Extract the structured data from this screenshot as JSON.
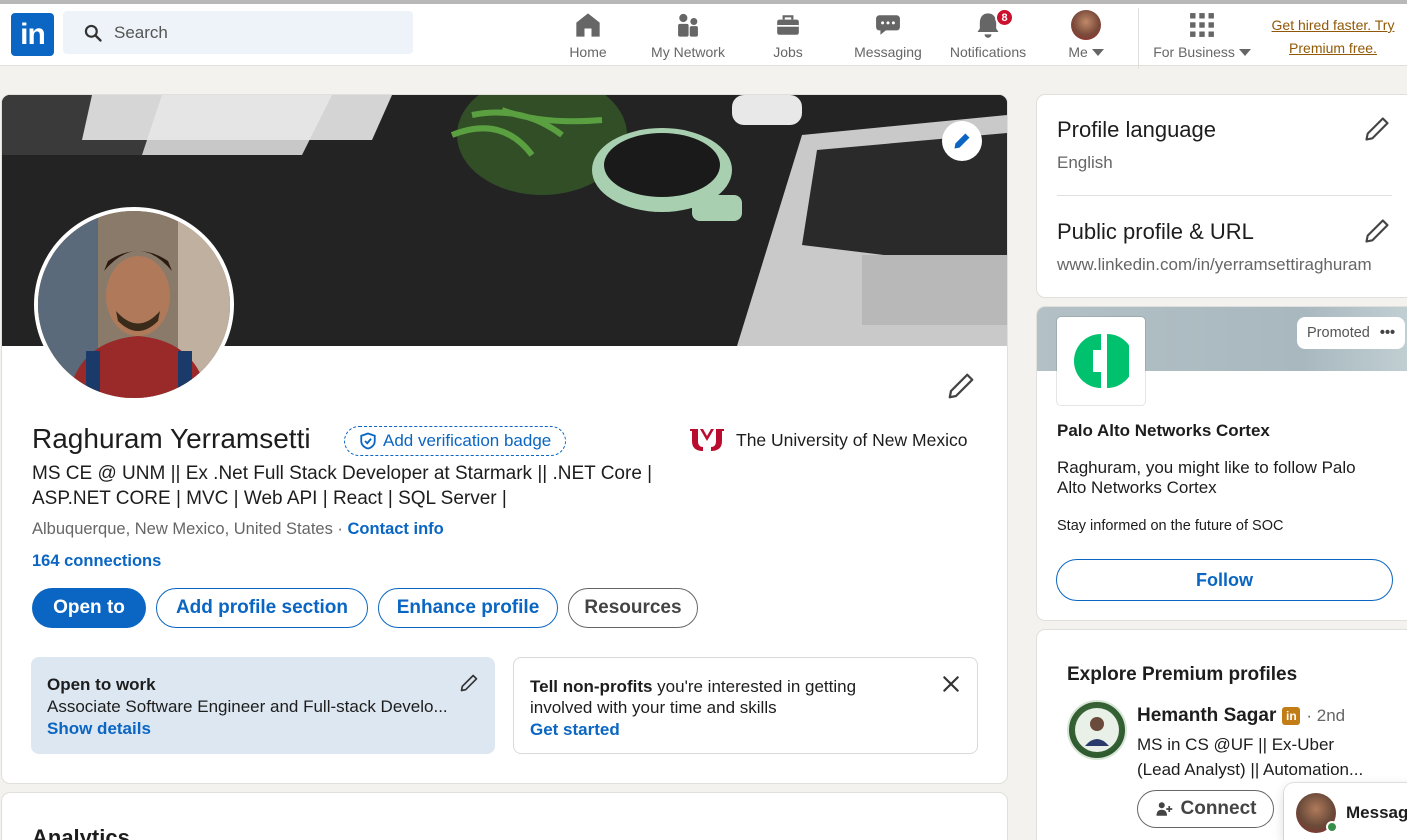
{
  "nav": {
    "logo": "in",
    "search_placeholder": "Search",
    "items": [
      {
        "label": "Home"
      },
      {
        "label": "My Network"
      },
      {
        "label": "Jobs"
      },
      {
        "label": "Messaging"
      },
      {
        "label": "Notifications",
        "badge": "8"
      },
      {
        "label": "Me"
      },
      {
        "label": "For Business"
      }
    ],
    "premium_line1": "Get hired faster. Try",
    "premium_line2": "Premium free."
  },
  "profile": {
    "name": "Raghuram Yerramsetti",
    "verify_badge": "Add verification badge",
    "headline": "MS CE @ UNM || Ex .Net Full Stack Developer at Starmark || .NET Core | ASP.NET CORE | MVC | Web API | React | SQL Server |",
    "school": "The University of New Mexico",
    "location": "Albuquerque, New Mexico, United States",
    "location_sep": " · ",
    "contact_info": "Contact info",
    "connections": "164 connections",
    "buttons": {
      "open_to": "Open to",
      "add_section": "Add profile section",
      "enhance": "Enhance profile",
      "resources": "Resources"
    },
    "open_to_work": {
      "title": "Open to work",
      "roles": "Associate Software Engineer and Full-stack Develo...",
      "link": "Show details"
    },
    "nonprofits": {
      "bold": "Tell non-profits",
      "text": " you're interested in getting involved with your time and skills",
      "link": "Get started"
    }
  },
  "analytics": {
    "title": "Analytics"
  },
  "sidebar": {
    "profile_language": {
      "title": "Profile language",
      "value": "English"
    },
    "public_profile": {
      "title": "Public profile & URL",
      "value": "www.linkedin.com/in/yerramsettiraghuram"
    },
    "ad": {
      "promoted": "Promoted",
      "more": "•••",
      "company": "Palo Alto Networks Cortex",
      "message": "Raghuram, you might like to follow Palo Alto Networks Cortex",
      "sub": "Stay informed on the future of SOC",
      "follow": "Follow",
      "logo_color": "#00c16e"
    },
    "premium_profiles": {
      "title": "Explore Premium profiles",
      "person": {
        "name": "Hemanth Sagar",
        "badge": "in",
        "degree": "· 2nd",
        "headline": "MS in CS @UF || Ex-Uber (Lead Analyst) || Automation..."
      },
      "connect": "Connect"
    }
  },
  "messaging_bar": {
    "label": "Messaging"
  },
  "colors": {
    "brand": "#0a66c2",
    "premium": "#915907",
    "badge": "#cb112d"
  }
}
